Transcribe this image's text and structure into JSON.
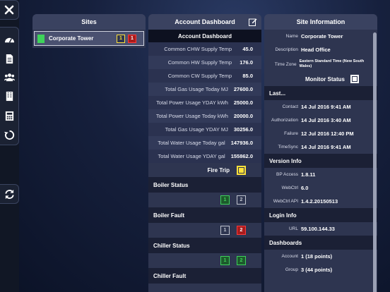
{
  "sites": {
    "title": "Sites",
    "items": [
      {
        "name": "Corporate Tower",
        "badge_yellow": "1",
        "badge_red": "1"
      }
    ]
  },
  "dashboard": {
    "title": "Account Dashboard",
    "subtitle": "Account Dashboard",
    "metrics": [
      {
        "label": "Common CHW Supply Temp",
        "value": "45.0"
      },
      {
        "label": "Common HW Supply Temp",
        "value": "176.0"
      },
      {
        "label": "Common CW Supply Temp",
        "value": "85.0"
      },
      {
        "label": "Total Gas Usage Today MJ",
        "value": "27600.0"
      },
      {
        "label": "Total Power Usage YDAY kWh",
        "value": "25000.0"
      },
      {
        "label": "Total Power Usage Today kWh",
        "value": "20000.0"
      },
      {
        "label": "Total Gas Usage YDAY MJ",
        "value": "30256.0"
      },
      {
        "label": "Total Water Usage Today gal",
        "value": "147936.0"
      },
      {
        "label": "Total Water Usage YDAY gal",
        "value": "155862.0"
      }
    ],
    "fire_trip": "Fire Trip",
    "sections": [
      {
        "title": "Boiler  Status",
        "badges": [
          {
            "text": "1",
            "color": "green"
          },
          {
            "text": "2",
            "color": "gray"
          }
        ]
      },
      {
        "title": "Boiler  Fault",
        "badges": [
          {
            "text": "1",
            "color": "gray"
          },
          {
            "text": "2",
            "color": "red"
          }
        ]
      },
      {
        "title": "Chiller  Status",
        "badges": [
          {
            "text": "1",
            "color": "green"
          },
          {
            "text": "2",
            "color": "green"
          }
        ]
      },
      {
        "title": "Chiller  Fault",
        "badges": []
      }
    ]
  },
  "site_info": {
    "title": "Site Information",
    "name_label": "Name",
    "name_value": "Corporate Tower",
    "desc_label": "Description",
    "desc_value": "Head Office",
    "tz_label": "Time Zone",
    "tz_value": "Eastern Standard Time (New South Wales)",
    "monitor_status": "Monitor Status",
    "last_title": "Last...",
    "last_rows": [
      {
        "k": "Contact",
        "v": "14 Jul 2016 9:41 AM"
      },
      {
        "k": "Authorization",
        "v": "14 Jul 2016 3:40 AM"
      },
      {
        "k": "Failure",
        "v": "12 Jul 2016 12:40 PM"
      },
      {
        "k": "TimeSync",
        "v": "14 Jul 2016 9:41 AM"
      }
    ],
    "version_title": "Version Info",
    "version_rows": [
      {
        "k": "BP Access",
        "v": "1.8.11"
      },
      {
        "k": "WebCtrl",
        "v": "6.0"
      },
      {
        "k": "WebCtrl API",
        "v": "1.4.2.20150513"
      }
    ],
    "login_title": "Login Info",
    "login_rows": [
      {
        "k": "URL",
        "v": "59.100.144.33"
      }
    ],
    "dash_title": "Dashboards",
    "dash_rows": [
      {
        "k": "Account",
        "v": "1  (18 points)"
      },
      {
        "k": "Group",
        "v": "3  (44 points)"
      }
    ]
  },
  "colors": {
    "accent_green": "#3ed35a",
    "alarm_red": "#ff3a3a",
    "warn_yellow": "#ffe23a"
  }
}
